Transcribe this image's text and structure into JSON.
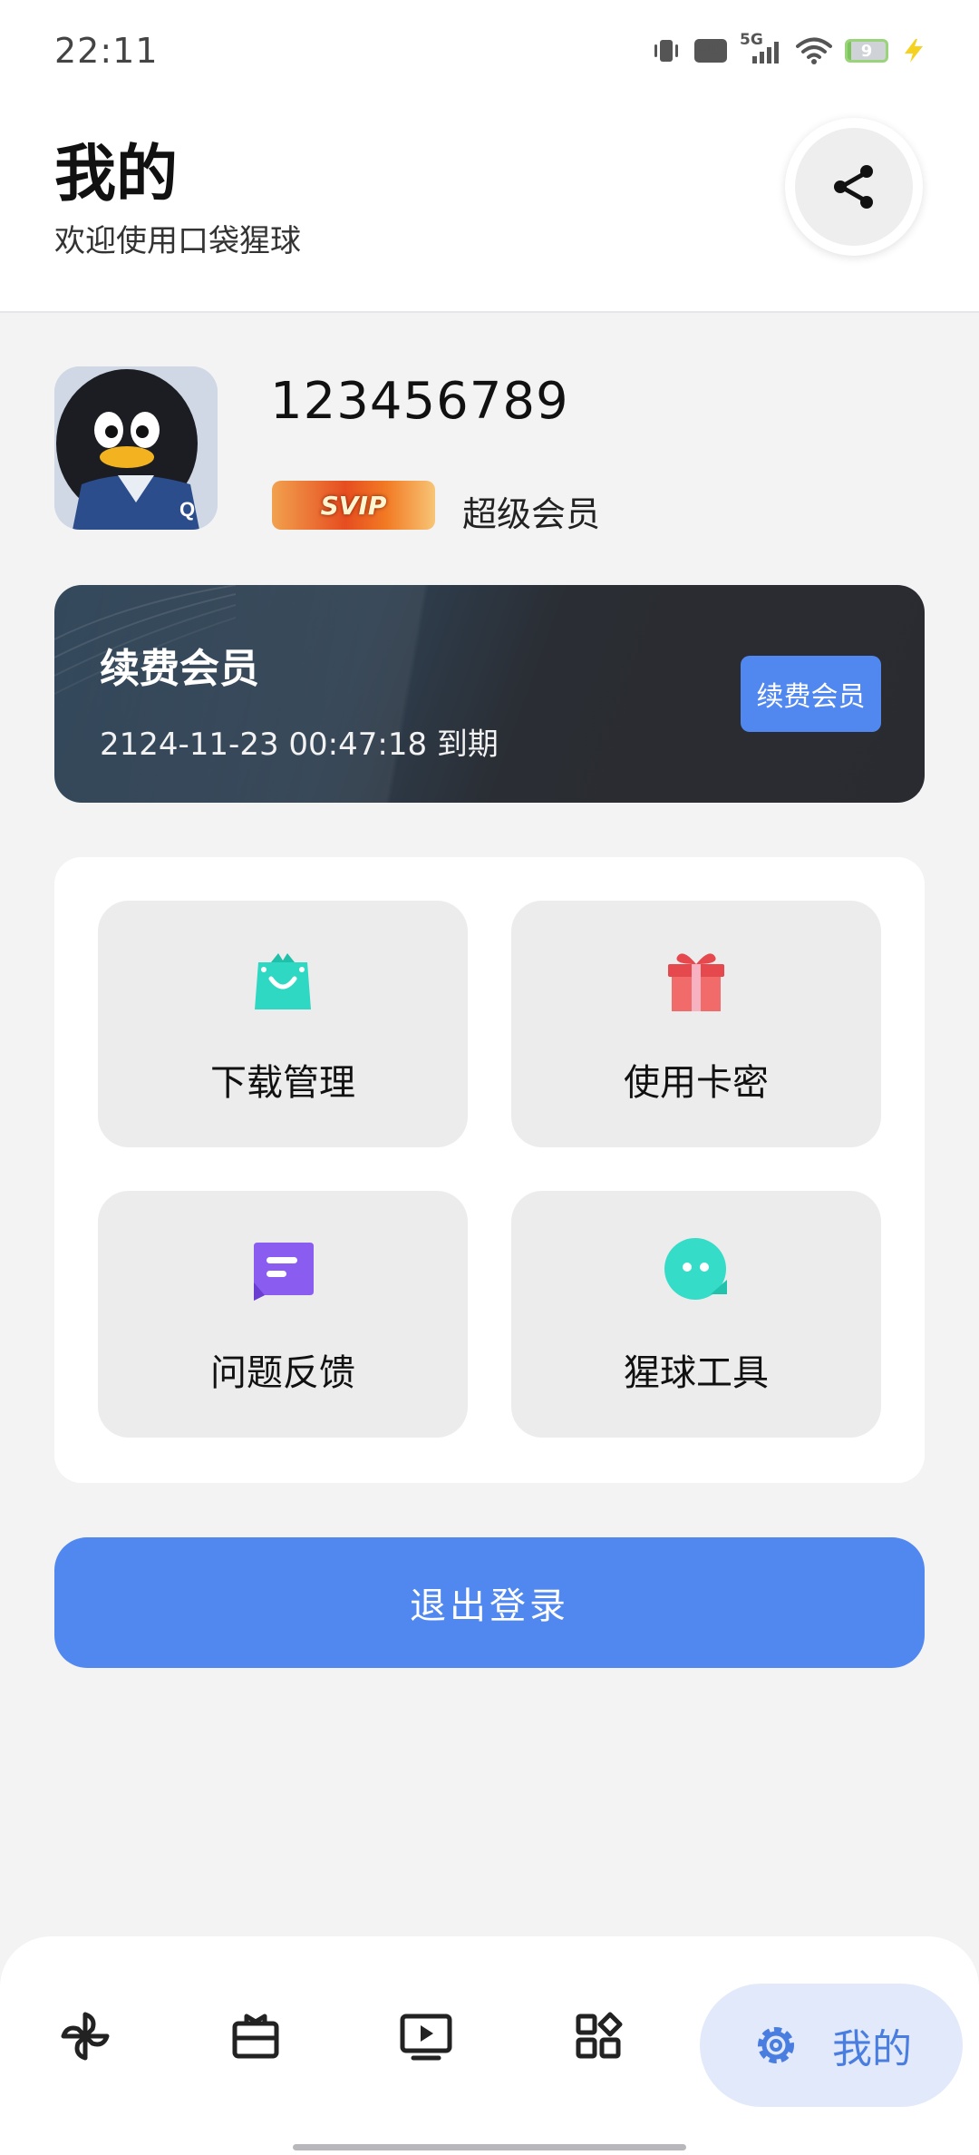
{
  "status_bar": {
    "time": "22:11",
    "hd": "HD",
    "network": "5G",
    "battery": "9",
    "icons": [
      "vibrate-icon",
      "hd-icon",
      "signal-icon",
      "wifi-icon",
      "battery-icon",
      "charging-icon"
    ]
  },
  "header": {
    "title": "我的",
    "subtitle": "欢迎使用口袋猩球",
    "share_icon": "share-icon"
  },
  "profile": {
    "user_id": "123456789",
    "badge": "SVIP",
    "level": "超级会员"
  },
  "renew_card": {
    "title": "续费会员",
    "expire_text": "2124-11-23 00:47:18 到期",
    "button_label": "续费会员"
  },
  "tools": [
    {
      "label": "下载管理",
      "icon": "shopping-bag-icon",
      "color": "#2fd8c2"
    },
    {
      "label": "使用卡密",
      "icon": "gift-icon",
      "color": "#f06a6a"
    },
    {
      "label": "问题反馈",
      "icon": "message-icon",
      "color": "#8a5cf0"
    },
    {
      "label": "猩球工具",
      "icon": "chat-bubble-icon",
      "color": "#35dcc7"
    }
  ],
  "logout_label": "退出登录",
  "bottom_nav": {
    "items": [
      "pinwheel-icon",
      "ticket-icon",
      "video-play-icon",
      "apps-icon"
    ],
    "active_label": "我的",
    "active_icon": "gear-icon"
  },
  "colors": {
    "accent": "#5088f0",
    "active_nav_bg": "#e1e9fb"
  }
}
